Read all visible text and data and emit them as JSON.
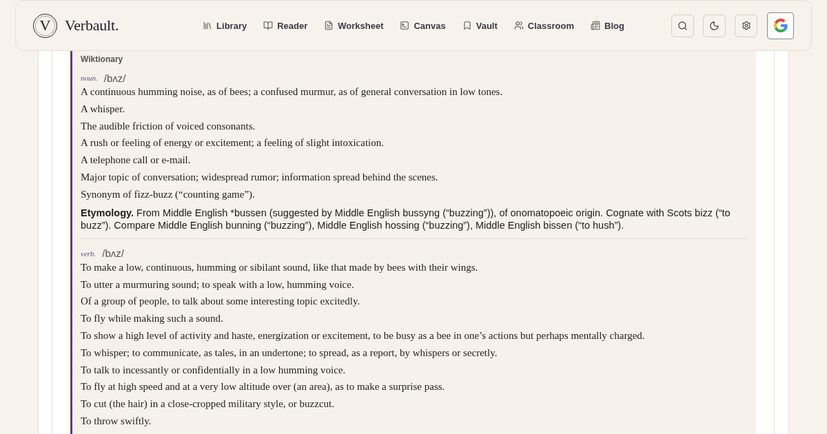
{
  "header": {
    "logo_letter": "V",
    "brand": "Verbault.",
    "nav": [
      {
        "label": "Library"
      },
      {
        "label": "Reader"
      },
      {
        "label": "Worksheet"
      },
      {
        "label": "Canvas"
      },
      {
        "label": "Vault"
      },
      {
        "label": "Classroom"
      },
      {
        "label": "Blog"
      }
    ]
  },
  "dictionary": {
    "source": "Wiktionary",
    "entries": [
      {
        "pos": "noun.",
        "pronunciation": "/bʌz/",
        "definitions": [
          "A continuous humming noise, as of bees; a confused murmur, as of general conversation in low tones.",
          "A whisper.",
          "The audible friction of voiced consonants.",
          "A rush or feeling of energy or excitement; a feeling of slight intoxication.",
          "A telephone call or e-mail.",
          "Major topic of conversation; widespread rumor; information spread behind the scenes.",
          "Synonym of fizz-buzz (“counting game”)."
        ],
        "etymology": "**Etymology.** From Middle English *bussen (suggested by Middle English bussyng (“buzzing”)), of onomatopoeic origin. Cognate with Scots bizz (“to buzz”). Compare Middle English bunning (“buzzing”), Middle English hossing (“buzzing”), Middle English bissen (“to hush”)."
      },
      {
        "pos": "verb.",
        "pronunciation": "/bʌz/",
        "definitions": [
          "To make a low, continuous, humming or sibilant sound, like that made by bees with their wings.",
          "To utter a murmuring sound; to speak with a low, humming voice.",
          "Of a group of people, to talk about some interesting topic excitedly.",
          "To fly while making such a sound.",
          "To show a high level of activity and haste, energization or excitement, to be busy as a bee in one’s actions but perhaps mentally charged.",
          "To whisper; to communicate, as tales, in an undertone; to spread, as a report, by whispers or secretly.",
          "To talk to incessantly or confidentially in a low humming voice.",
          "To fly at high speed and at a very low altitude over (an area), as to make a surprise pass.",
          "To cut (the hair) in a close-cropped military style, or buzzcut.",
          "To throw swiftly."
        ]
      }
    ]
  }
}
